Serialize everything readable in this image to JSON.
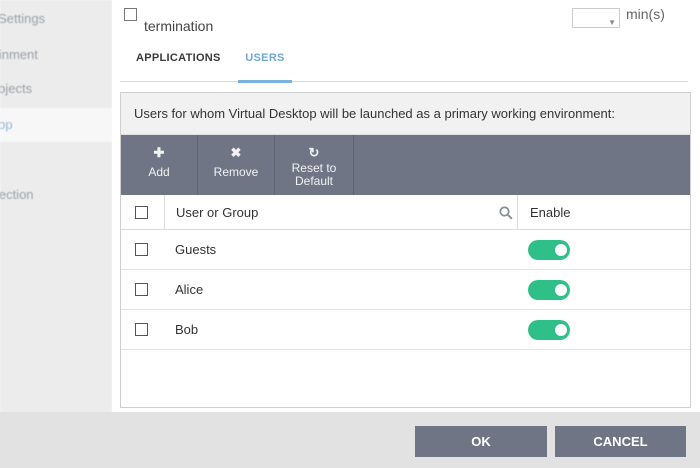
{
  "background": {
    "sidebar_items": [
      {
        "label": "k Settings",
        "active": false
      },
      {
        "label": "tainment",
        "active": false
      },
      {
        "label": "Objects",
        "active": false
      },
      {
        "label": "ktop",
        "active": true
      },
      {
        "label": "otection",
        "active": false
      }
    ]
  },
  "top_setting": {
    "label": "termination",
    "spinner_value": "",
    "unit": "min(s)"
  },
  "tabs": [
    {
      "label": "APPLICATIONS",
      "active": false
    },
    {
      "label": "USERS",
      "active": true
    }
  ],
  "panel": {
    "description": "Users for whom Virtual Desktop will be launched as a primary working environment:",
    "toolbar": {
      "add": {
        "icon": "plus-icon",
        "label": "Add"
      },
      "remove": {
        "icon": "x-icon",
        "label": "Remove"
      },
      "reset": {
        "icon": "refresh-icon",
        "label_line1": "Reset to",
        "label_line2": "Default"
      }
    },
    "table": {
      "columns": {
        "user_or_group": "User or Group",
        "enable": "Enable"
      },
      "rows": [
        {
          "name": "Guests",
          "enabled": true
        },
        {
          "name": "Alice",
          "enabled": true
        },
        {
          "name": "Bob",
          "enabled": true
        }
      ]
    }
  },
  "buttons": {
    "ok": "OK",
    "cancel": "CANCEL"
  },
  "colors": {
    "toolbar": "#6f7585",
    "toggle_on": "#2fc08a",
    "active_tab": "#6fa8d8"
  }
}
